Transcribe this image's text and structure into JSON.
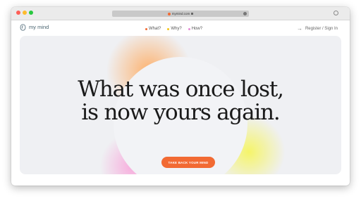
{
  "browser": {
    "url": "mymind.com"
  },
  "site": {
    "logo_text": "my mind",
    "nav": [
      {
        "label": "What?",
        "dot_color": "#f26a33"
      },
      {
        "label": "Why?",
        "dot_color": "#f5c518"
      },
      {
        "label": "How?",
        "dot_color": "#e58bd6"
      }
    ],
    "register_label": "Register / Sign In"
  },
  "hero": {
    "headline_line1": "What was once lost,",
    "headline_line2": "is now yours again.",
    "cta_label": "TAKE BACK YOUR MIND"
  },
  "colors": {
    "accent": "#f26a33",
    "hero_bg": "#eff0f3"
  }
}
